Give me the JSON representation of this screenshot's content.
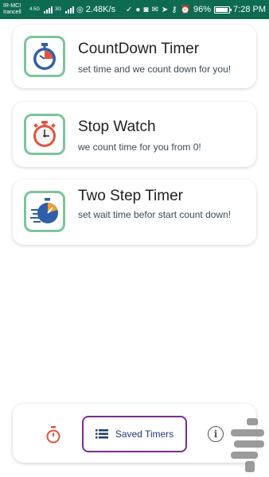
{
  "status_bar": {
    "carrier_top": "IR-MCI",
    "carrier_bottom": "Irancell",
    "net_top": "4.5G",
    "net_bottom": "3G",
    "speed": "2.48K/s",
    "battery": "96%",
    "time": "7:28 PM"
  },
  "cards": [
    {
      "title": "CountDown Timer",
      "subtitle": "set time and we count down for you!",
      "icon": "countdown-timer-icon"
    },
    {
      "title": "Stop Watch",
      "subtitle": "we count time for you from 0!",
      "icon": "stopwatch-icon"
    },
    {
      "title": "Two Step Timer",
      "subtitle": "set wait time befor start count down!",
      "icon": "fast-timer-icon"
    }
  ],
  "bottom_nav": {
    "saved_label": "Saved Timers",
    "timer_icon": "stopwatch-icon",
    "saved_icon": "list-icon",
    "info_icon": "info-icon",
    "info_glyph": "i"
  },
  "colors": {
    "status_bar": "#0e6b52",
    "icon_border": "#7cc49a",
    "highlight": "#7b2c8f",
    "accent_red": "#e0533f",
    "accent_blue": "#2f5fa8"
  }
}
